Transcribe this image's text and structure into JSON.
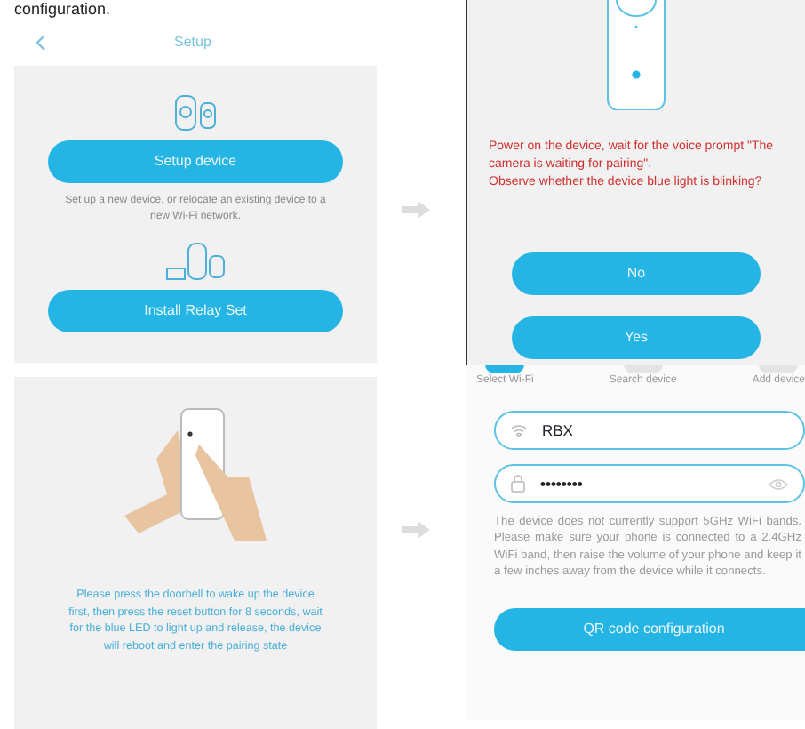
{
  "caption": "configuration.",
  "setup_screen": {
    "title": "Setup",
    "buttons": [
      {
        "label": "Setup device",
        "note": "Set up a new device, or relocate an existing device to a new Wi-Fi network."
      },
      {
        "label": "Install Relay Set"
      }
    ]
  },
  "pairing_screen": {
    "prompt": "Power on the device, wait for the voice prompt \"The camera is waiting for pairing\".\nObserve whether the device blue light is blinking?",
    "buttons": [
      "No",
      "Yes"
    ]
  },
  "reset_screen": {
    "instruction": "Please press the doorbell to wake up the device first, then press the reset button for 8 seconds, wait for the blue LED to light up and release, the device will reboot and enter the pairing state"
  },
  "wifi_screen": {
    "steps": [
      {
        "label": "Select Wi-Fi",
        "selected": true
      },
      {
        "label": "Search device",
        "selected": false
      },
      {
        "label": "Add device",
        "selected": false
      }
    ],
    "ssid": "RBX",
    "password": "••••••••",
    "note": "The device does not currently support 5GHz WiFi bands. Please make sure your phone is connected to a 2.4GHz WiFi band, then raise the volume of your phone and keep it a few inches away from the device while it connects.",
    "button": "QR code configuration"
  }
}
